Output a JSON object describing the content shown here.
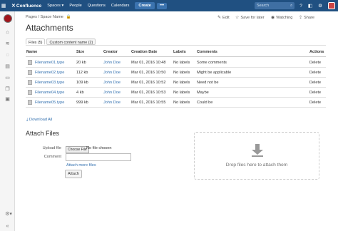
{
  "topbar": {
    "logo": "Confluence",
    "nav": [
      "Spaces ▾",
      "People",
      "Questions",
      "Calendars"
    ],
    "create": "Create",
    "more": "•••",
    "search_placeholder": "Search"
  },
  "breadcrumb": [
    "Pages",
    "Space Name"
  ],
  "page_actions": {
    "edit": "Edit",
    "save": "Save for later",
    "watch": "Watching",
    "share": "Share"
  },
  "title": "Attachments",
  "tabs": [
    "Files (5)",
    "Custom content name (2)"
  ],
  "table": {
    "headers": [
      "Name",
      "Size",
      "Creator",
      "Creation Date",
      "Labels",
      "Comments",
      "Actions"
    ],
    "rows": [
      {
        "name": "Filename01.type",
        "size": "20 kb",
        "creator": "John Doe",
        "date": "Mar 01, 2016 10:48",
        "labels": "No labels",
        "comment": "Some comments",
        "action": "Delete"
      },
      {
        "name": "Filename02.type",
        "size": "112 kb",
        "creator": "John Doe",
        "date": "Mar 01, 2016 10:50",
        "labels": "No labels",
        "comment": "Might be applicable",
        "action": "Delete"
      },
      {
        "name": "Filename03.type",
        "size": "109 kb",
        "creator": "John Doe",
        "date": "Mar 01, 2016 10:52",
        "labels": "No labels",
        "comment": "Need not be",
        "action": "Delete"
      },
      {
        "name": "Filename04.type",
        "size": "4 kb",
        "creator": "John Doe",
        "date": "Mar 01, 2016 10:53",
        "labels": "No labels",
        "comment": "Maybe",
        "action": "Delete"
      },
      {
        "name": "Filename05.type",
        "size": "999 kb",
        "creator": "John Doe",
        "date": "Mar 01, 2016 10:55",
        "labels": "No labels",
        "comment": "Could be",
        "action": "Delete"
      }
    ]
  },
  "download_all": "Download All",
  "attach": {
    "title": "Attach Files",
    "upload_label": "Upload file",
    "choose_file": "Choose File",
    "no_file": "No file chosen",
    "comment_label": "Comment",
    "attach_more": "Attach more files",
    "attach_button": "Attach",
    "drop_text": "Drop files here to attach them"
  },
  "colors": {
    "header_bg": "#205081",
    "link": "#3572b0",
    "create_button": "#3b73af"
  },
  "icons": [
    "app-switcher-icon",
    "help-icon",
    "notifications-icon",
    "settings-icon",
    "lock-icon",
    "pencil-icon",
    "star-icon",
    "eye-icon",
    "share-icon",
    "download-icon",
    "upload-arrow-icon"
  ]
}
